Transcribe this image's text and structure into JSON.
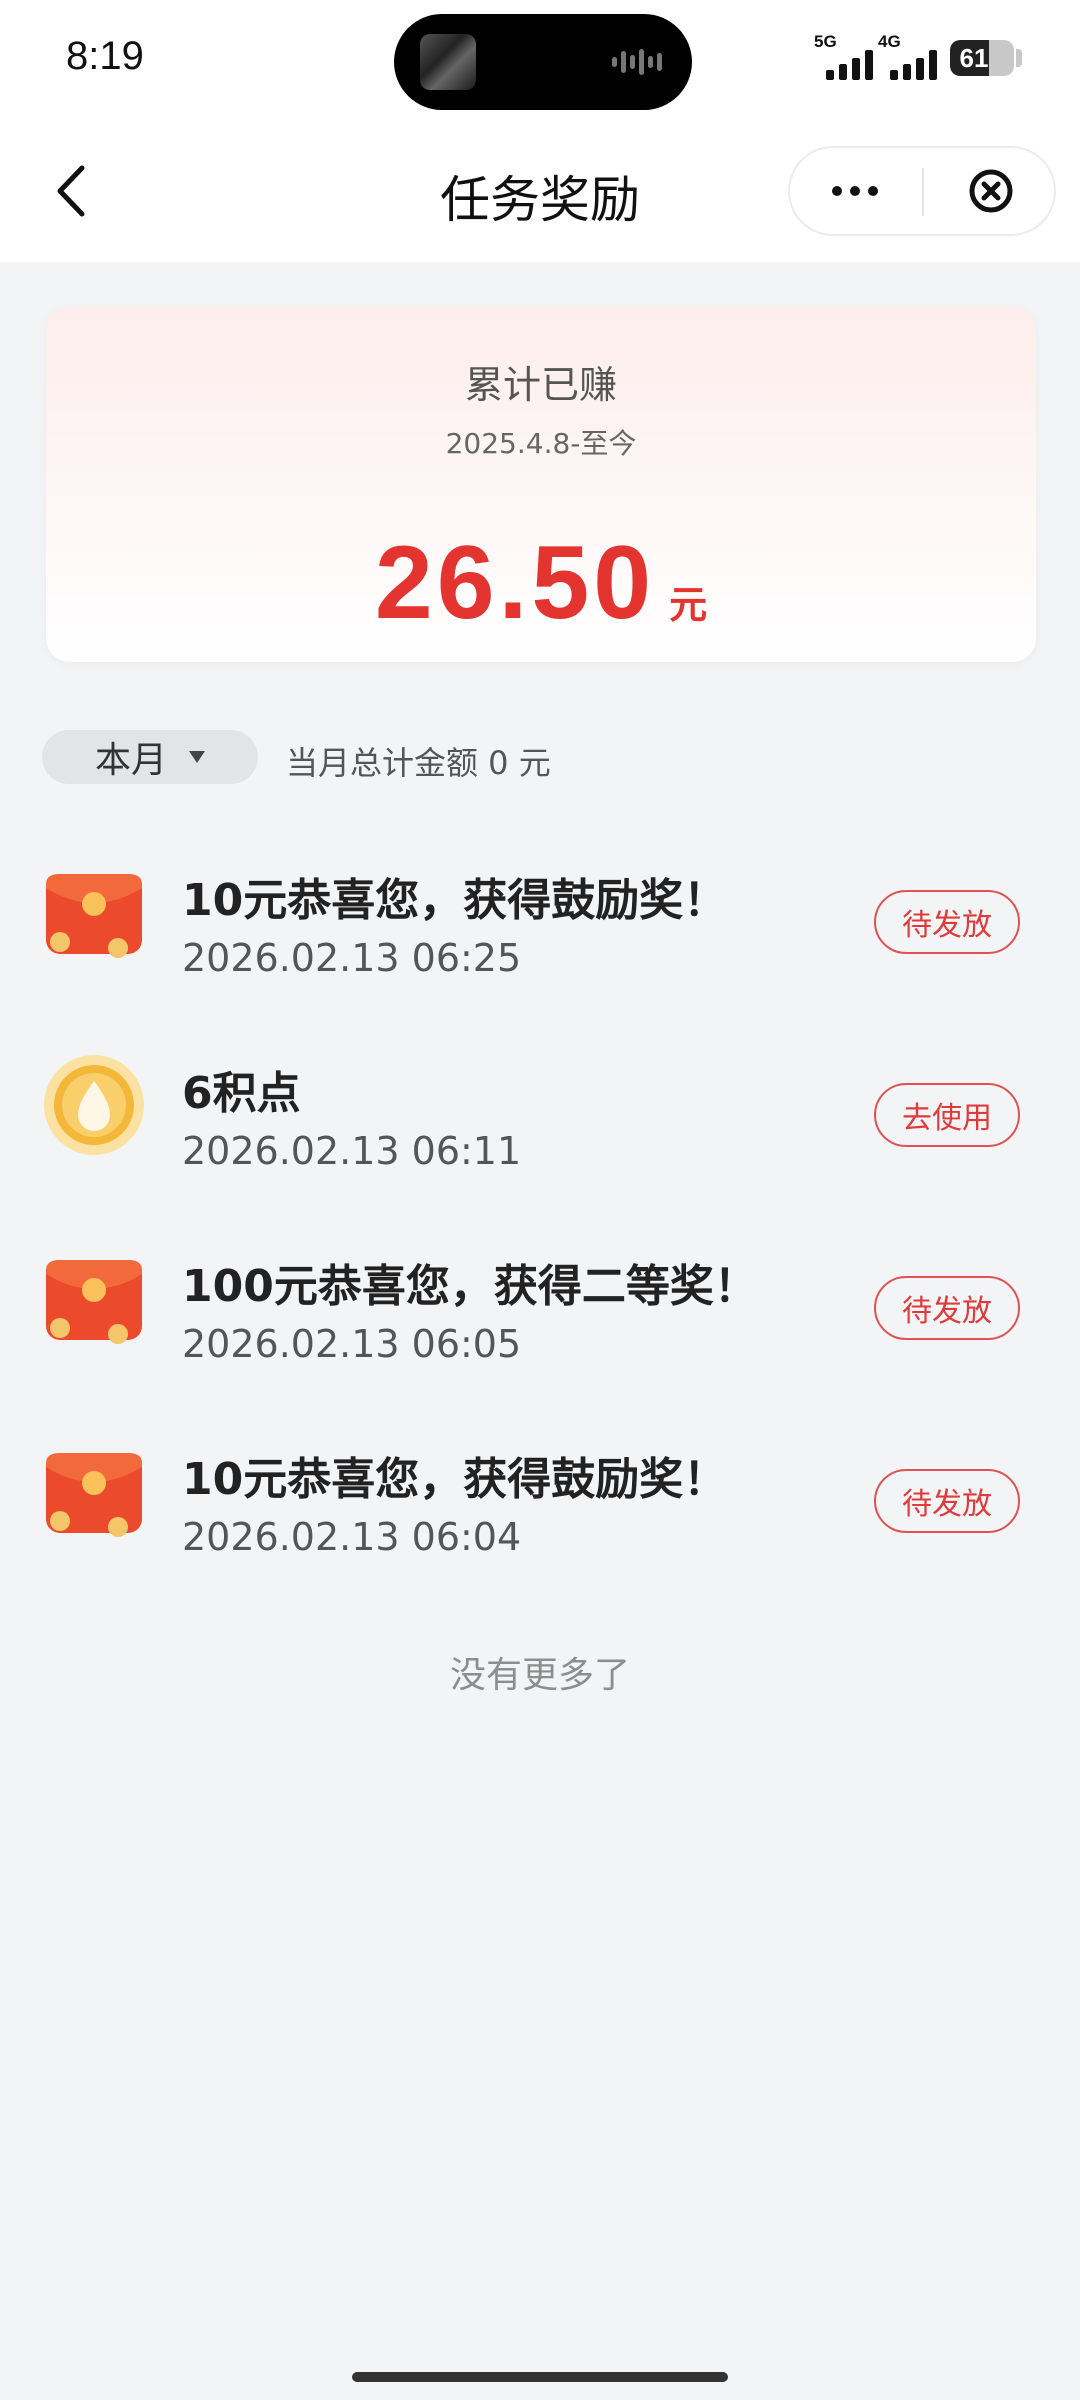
{
  "status_bar": {
    "time": "8:19",
    "network_1": "5G",
    "network_2": "4G",
    "battery": "61",
    "battery_level": 0.61
  },
  "nav": {
    "title": "任务奖励",
    "back_icon": "chevron-left-icon",
    "more_icon": "more-dots-icon",
    "close_icon": "close-circle-icon"
  },
  "summary": {
    "title": "累计已赚",
    "range": "2025.4.8-至今",
    "amount": "26.50",
    "unit": "元",
    "amount_color": "#e3342f"
  },
  "filter": {
    "month_label": "本月",
    "month_total": "当月总计金额 0 元"
  },
  "rewards": [
    {
      "title": "10元恭喜您，获得鼓励奖！",
      "time": "2026.02.13 06:25",
      "action": "待发放",
      "icon": "red-envelope-icon"
    },
    {
      "title": "6积点",
      "time": "2026.02.13 06:11",
      "action": "去使用",
      "icon": "gold-coin-icon"
    },
    {
      "title": "100元恭喜您，获得二等奖！",
      "time": "2026.02.13 06:05",
      "action": "待发放",
      "icon": "red-envelope-icon"
    },
    {
      "title": "10元恭喜您，获得鼓励奖！",
      "time": "2026.02.13 06:04",
      "action": "待发放",
      "icon": "red-envelope-icon"
    }
  ],
  "footer": {
    "no_more": "没有更多了"
  },
  "colors": {
    "accent_red": "#e03a3a",
    "page_background": "#f3f4f6"
  }
}
